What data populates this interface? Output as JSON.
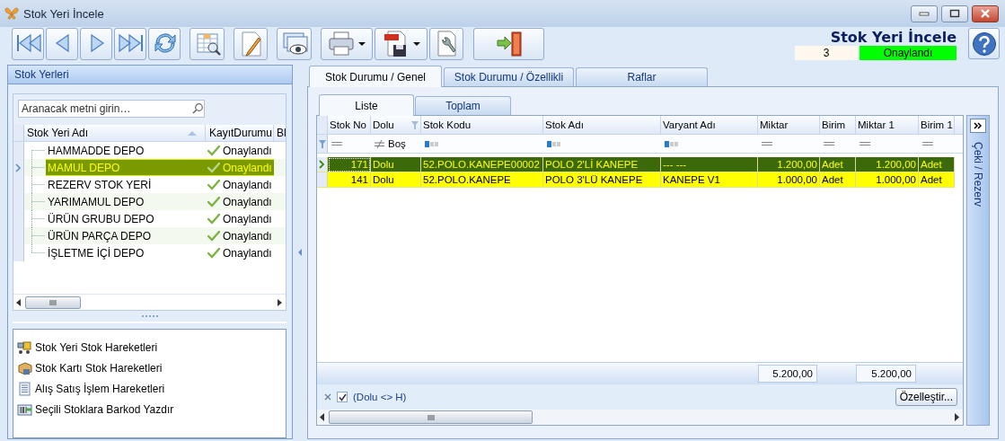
{
  "window": {
    "title": "Stok Yeri İncele"
  },
  "header": {
    "title": "Stok Yeri İncele",
    "number": "3",
    "status": "Onaylandı"
  },
  "left_panel": {
    "title": "Stok Yerleri",
    "search": {
      "placeholder": "Aranacak metni girin…"
    },
    "columns": [
      {
        "label": "Stok Yeri Adı",
        "sorted": true
      },
      {
        "label": "KayıtDurumu"
      },
      {
        "label": "Bl"
      }
    ],
    "rows": [
      {
        "name": "HAMMADDE DEPO",
        "status": "Onaylandı",
        "selected": false
      },
      {
        "name": "MAMUL DEPO",
        "status": "Onaylandı",
        "selected": true
      },
      {
        "name": "REZERV STOK YERİ",
        "status": "Onaylandı",
        "selected": false
      },
      {
        "name": "YARIMAMUL DEPO",
        "status": "Onaylandı",
        "selected": false
      },
      {
        "name": "ÜRÜN GRUBU DEPO",
        "status": "Onaylandı",
        "selected": false
      },
      {
        "name": "ÜRÜN PARÇA DEPO",
        "status": "Onaylandı",
        "selected": false
      },
      {
        "name": "İŞLETME İÇİ DEPO",
        "status": "Onaylandı",
        "selected": false
      }
    ],
    "actions": [
      "Stok Yeri Stok Hareketleri",
      "Stok Kartı Stok Hareketleri",
      "Alış Satış İşlem Hareketleri",
      "Seçili Stoklara Barkod Yazdır"
    ]
  },
  "tabs": [
    {
      "label": "Stok Durumu / Genel",
      "selected": true
    },
    {
      "label": "Stok Durumu / Özellikli",
      "selected": false
    },
    {
      "label": "Raflar",
      "selected": false
    }
  ],
  "subtabs": [
    {
      "label": "Liste",
      "selected": true
    },
    {
      "label": "Toplam",
      "selected": false
    }
  ],
  "grid": {
    "columns": [
      {
        "label": "Stok No",
        "numeric": true,
        "kind": "equals"
      },
      {
        "label": "Dolu",
        "kind": "not_equal",
        "filter_value": "Boş",
        "filtered": true
      },
      {
        "label": "Stok Kodu",
        "kind": "text"
      },
      {
        "label": "Stok Adı",
        "kind": "text"
      },
      {
        "label": "Varyant Adı",
        "kind": "text"
      },
      {
        "label": "Miktar",
        "numeric": true,
        "kind": "equals",
        "total": "5.200,00"
      },
      {
        "label": "Birim",
        "kind": "equals"
      },
      {
        "label": "Miktar 1",
        "numeric": true,
        "kind": "equals",
        "total": "5.200,00"
      },
      {
        "label": "Birim 1",
        "kind": "equals"
      }
    ],
    "rows": [
      {
        "cells": [
          "171",
          "Dolu",
          "52.POLO.KANEPE00002",
          "POLO 2'Lİ KANEPE",
          "--- ---",
          "1.200,00",
          "Adet",
          "1.200,00",
          "Adet"
        ],
        "selected": true,
        "highlighted": true
      },
      {
        "cells": [
          "141",
          "Dolu",
          "52.POLO.KANEPE",
          "POLO 3'LÜ KANEPE",
          "KANEPE V1",
          "1.000,00",
          "Adet",
          "1.000,00",
          "Adet"
        ],
        "selected": false,
        "highlighted": true
      }
    ],
    "filter": {
      "enabled": true,
      "text": "(Dolu <> H)"
    },
    "customize_button": "Özelleştir..."
  },
  "side_panel": {
    "label": "Çeki / Rezerv"
  }
}
